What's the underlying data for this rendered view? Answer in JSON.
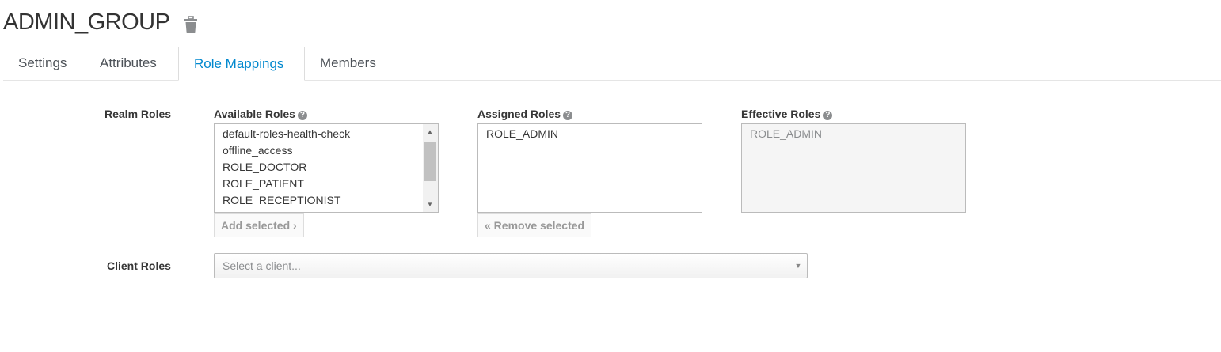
{
  "header": {
    "title": "ADMIN_GROUP",
    "delete_icon": "trash-icon"
  },
  "tabs": [
    {
      "label": "Settings"
    },
    {
      "label": "Attributes"
    },
    {
      "label": "Role Mappings",
      "active": true
    },
    {
      "label": "Members"
    }
  ],
  "realm_roles": {
    "label": "Realm Roles",
    "available": {
      "label": "Available Roles",
      "items": [
        "default-roles-health-check",
        "offline_access",
        "ROLE_DOCTOR",
        "ROLE_PATIENT",
        "ROLE_RECEPTIONIST"
      ],
      "button": "Add selected ›"
    },
    "assigned": {
      "label": "Assigned Roles",
      "items": [
        "ROLE_ADMIN"
      ],
      "button": "« Remove selected"
    },
    "effective": {
      "label": "Effective Roles",
      "items": [
        "ROLE_ADMIN"
      ]
    }
  },
  "client_roles": {
    "label": "Client Roles",
    "placeholder": "Select a client..."
  },
  "accent_color": "#0088ce"
}
